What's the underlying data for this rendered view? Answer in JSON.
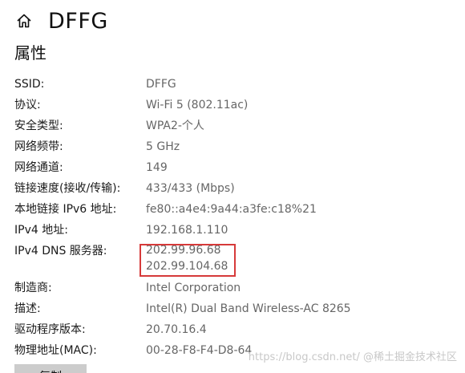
{
  "header": {
    "title": "DFFG",
    "home_icon": "home-icon"
  },
  "section": {
    "title": "属性"
  },
  "properties": [
    {
      "label": "SSID:",
      "value": "DFFG"
    },
    {
      "label": "协议:",
      "value": "Wi-Fi 5 (802.11ac)"
    },
    {
      "label": "安全类型:",
      "value": "WPA2-个人"
    },
    {
      "label": "网络频带:",
      "value": "5 GHz"
    },
    {
      "label": "网络通道:",
      "value": "149"
    },
    {
      "label": "链接速度(接收/传输):",
      "value": "433/433 (Mbps)"
    },
    {
      "label": "本地链接 IPv6 地址:",
      "value": "fe80::a4e4:9a44:a3fe:c18%21"
    },
    {
      "label": "IPv4 地址:",
      "value": "192.168.1.110"
    }
  ],
  "dns": {
    "label": "IPv4 DNS 服务器:",
    "values": [
      "202.99.96.68",
      "202.99.104.68"
    ]
  },
  "properties2": [
    {
      "label": "制造商:",
      "value": "Intel Corporation"
    },
    {
      "label": "描述:",
      "value": "Intel(R) Dual Band Wireless-AC 8265"
    },
    {
      "label": "驱动程序版本:",
      "value": "20.70.16.4"
    },
    {
      "label": "物理地址(MAC):",
      "value": "00-28-F8-F4-D8-64"
    }
  ],
  "copy_button": {
    "label": "复制"
  },
  "watermark": {
    "text": "https://blog.csdn.net/  @稀土掘金技术社区"
  },
  "colors": {
    "highlight": "#d63a3a",
    "value_text": "#666666",
    "button_bg": "#cccccc"
  }
}
